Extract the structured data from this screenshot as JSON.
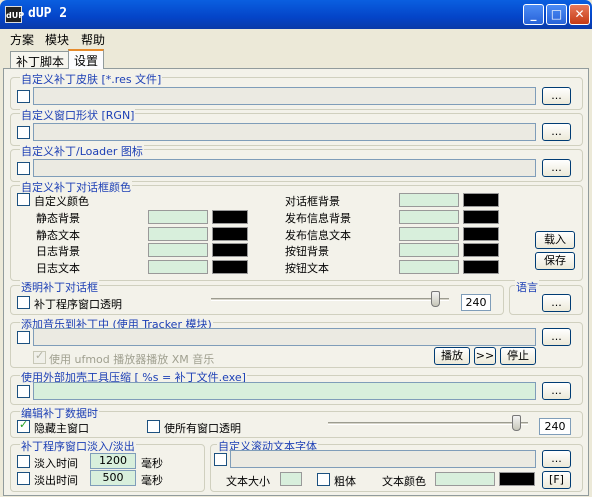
{
  "window": {
    "title": "dUP 2",
    "icon": "dUP"
  },
  "title_buttons": {
    "minimize": "_",
    "maximize": "□",
    "close": "✕"
  },
  "menu": [
    "方案",
    "模块",
    "帮助"
  ],
  "tabs": [
    "补丁脚本",
    "设置"
  ],
  "skin": {
    "label": "自定义补丁皮肤 [*.res 文件]",
    "browse": "..."
  },
  "shape": {
    "label": "自定义窗口形状 [RGN]",
    "browse": "..."
  },
  "loader_icon": {
    "label": "自定义补丁/Loader 图标",
    "browse": "..."
  },
  "colors": {
    "label": "自定义补丁对话框颜色",
    "custom": "自定义颜色",
    "left": [
      {
        "name": "静态背景",
        "color": "#d8efdc"
      },
      {
        "name": "静态文本",
        "color": "#000000"
      },
      {
        "name": "日志背景",
        "color": "#d8efdc"
      },
      {
        "name": "日志文本",
        "color": "#d8efdc"
      }
    ],
    "right": [
      {
        "name": "对话框背景",
        "color": "#d8efdc"
      },
      {
        "name": "发布信息背景",
        "color": "#d8efdc"
      },
      {
        "name": "发布信息文本",
        "color": "#d8efdc"
      },
      {
        "name": "按钮背景",
        "color": "#d8efdc"
      },
      {
        "name": "按钮文本",
        "color": "#d8efdc"
      }
    ],
    "load": "载入",
    "save": "保存"
  },
  "transparent": {
    "label": "透明补丁对话框",
    "checkbox": "补丁程序窗口透明",
    "value": "240",
    "level": 0.94
  },
  "language": {
    "label": "语言",
    "browse": "..."
  },
  "music": {
    "label": "添加音乐到补丁中 (使用 Tracker 模块)",
    "checkbox": "使用 ufmod 播放器播放 XM 音乐",
    "play": "播放",
    "next": ">>",
    "stop": "停止",
    "browse": "..."
  },
  "packer": {
    "label": "使用外部加壳工具压缩 [ %s = 补丁文件.exe]",
    "browse": "..."
  },
  "edit": {
    "label": "编辑补丁数据时",
    "hide": "隐藏主窗口",
    "transparent_all": "使所有窗口透明",
    "value": "240",
    "level": 0.94
  },
  "fade": {
    "label": "补丁程序窗口淡入/淡出",
    "fade_in": "淡入时间",
    "fade_in_value": "1200",
    "fade_out": "淡出时间",
    "fade_out_value": "500",
    "unit": "毫秒"
  },
  "scroll": {
    "label": "自定义滚动文本字体",
    "browse": "...",
    "size": "文本大小",
    "bold": "粗体",
    "color": "文本颜色",
    "font_btn": "[F]"
  }
}
